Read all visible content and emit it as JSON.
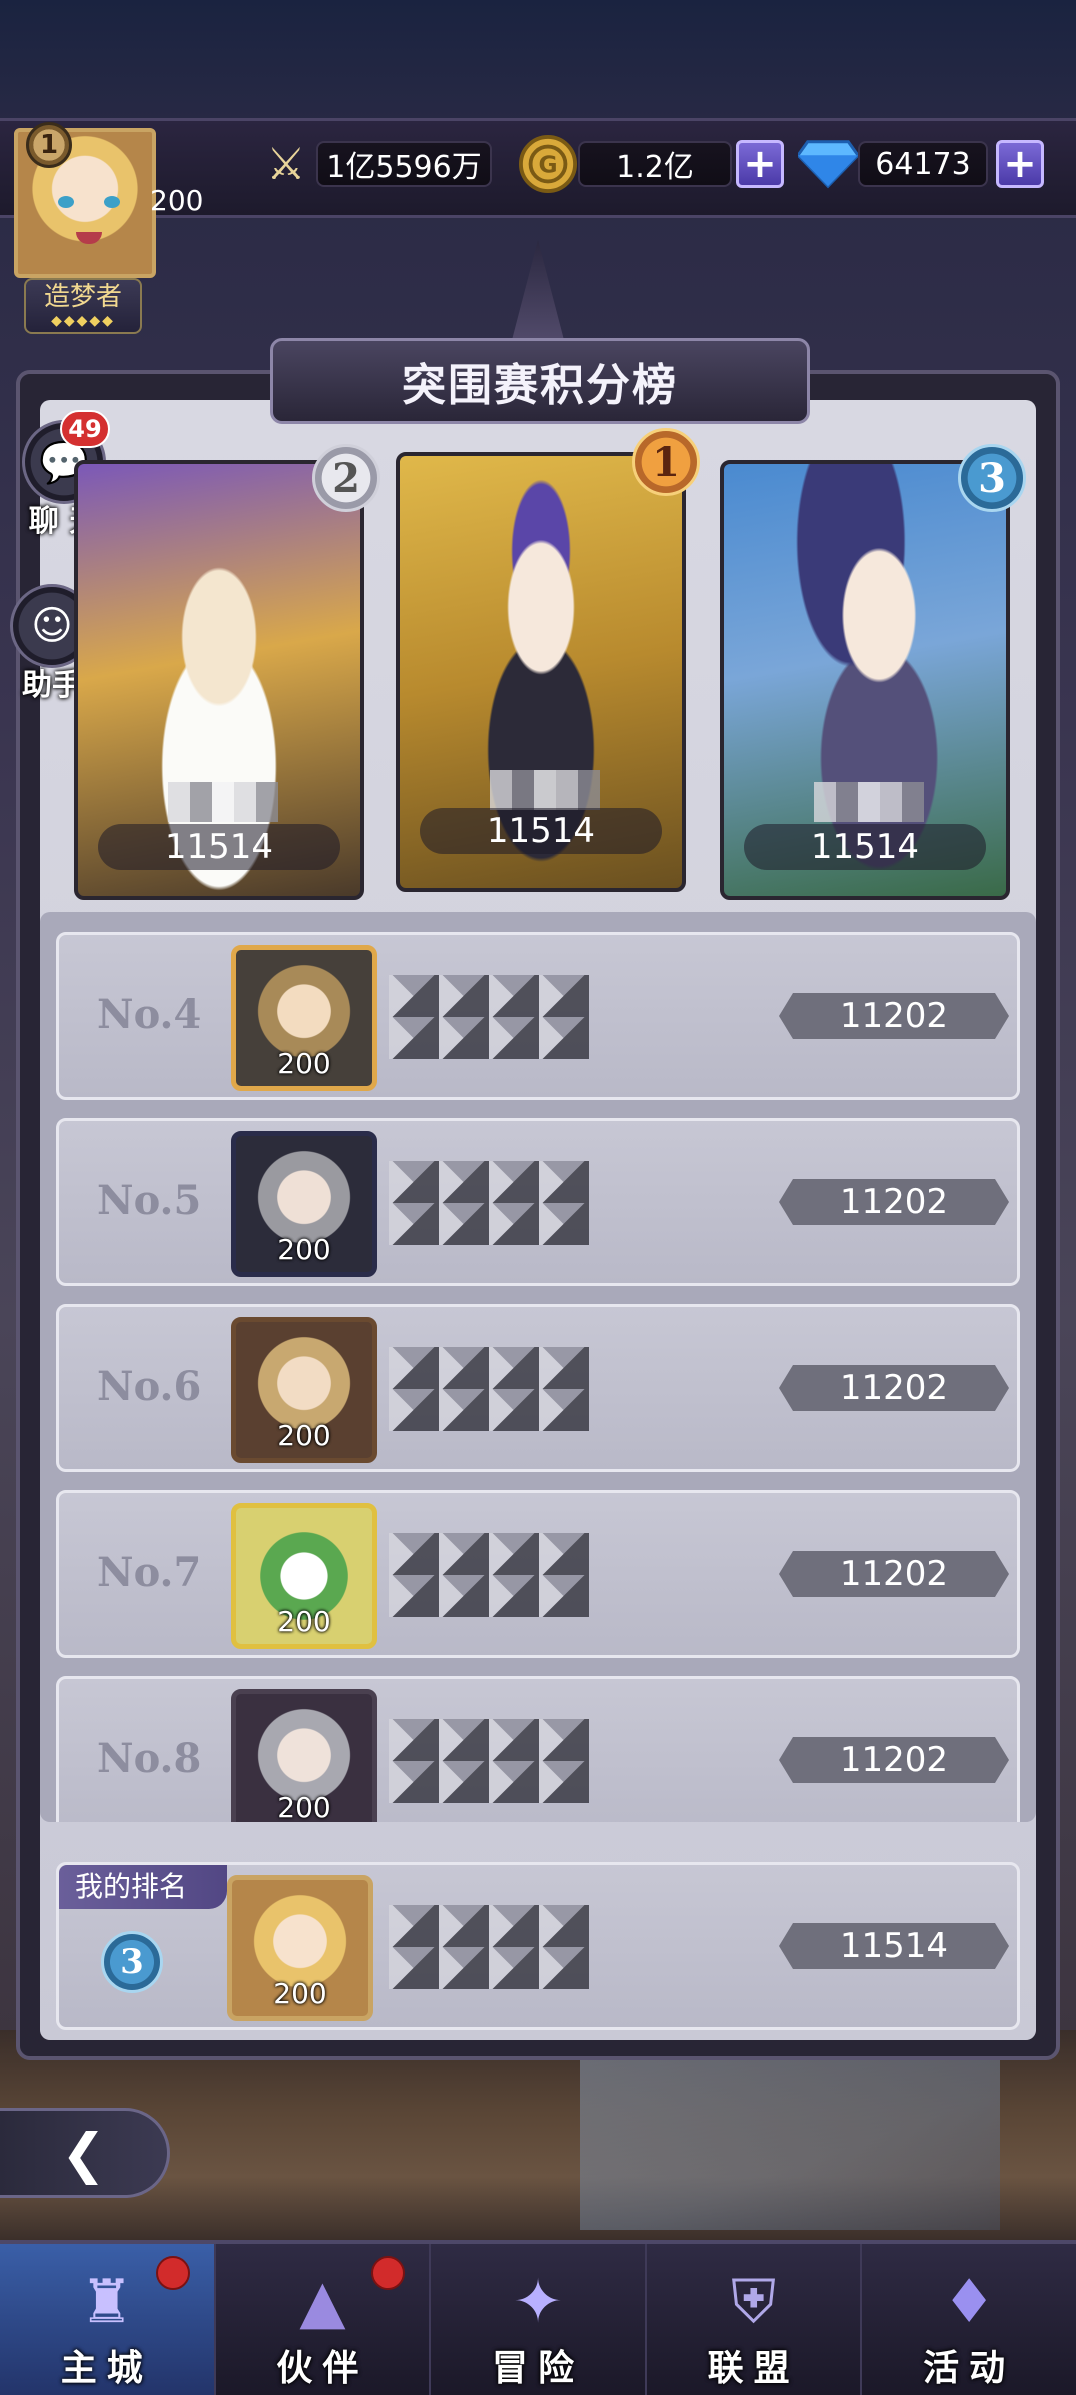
{
  "player": {
    "vip": "1",
    "level": "200",
    "title": "造梦者",
    "title_stars": "◆◆◆◆◆"
  },
  "resources": {
    "power": "1亿5596万",
    "gold": "1.2亿",
    "gems": "64173",
    "plus": "+"
  },
  "page_title": "突围赛积分榜",
  "side": {
    "chat_label": "聊 天",
    "chat_badge": "49",
    "helper_label": "助手"
  },
  "top3": [
    {
      "rank": "2",
      "score": "11514"
    },
    {
      "rank": "1",
      "score": "11514"
    },
    {
      "rank": "3",
      "score": "11514"
    }
  ],
  "rows": [
    {
      "rank": "No.4",
      "level": "200",
      "score": "11202"
    },
    {
      "rank": "No.5",
      "level": "200",
      "score": "11202"
    },
    {
      "rank": "No.6",
      "level": "200",
      "score": "11202"
    },
    {
      "rank": "No.7",
      "level": "200",
      "score": "11202"
    },
    {
      "rank": "No.8",
      "level": "200",
      "score": "11202"
    }
  ],
  "my_rank": {
    "tag": "我的排名",
    "rank": "3",
    "level": "200",
    "score": "11514"
  },
  "nav": [
    {
      "label": "主城",
      "icon": "castle-icon",
      "active": true,
      "dot": true
    },
    {
      "label": "伙伴",
      "icon": "hat-icon",
      "active": false,
      "dot": true
    },
    {
      "label": "冒险",
      "icon": "compass-icon",
      "active": false,
      "dot": false
    },
    {
      "label": "联盟",
      "icon": "shield-icon",
      "active": false,
      "dot": false
    },
    {
      "label": "活动",
      "icon": "cards-icon",
      "active": false,
      "dot": false
    }
  ]
}
